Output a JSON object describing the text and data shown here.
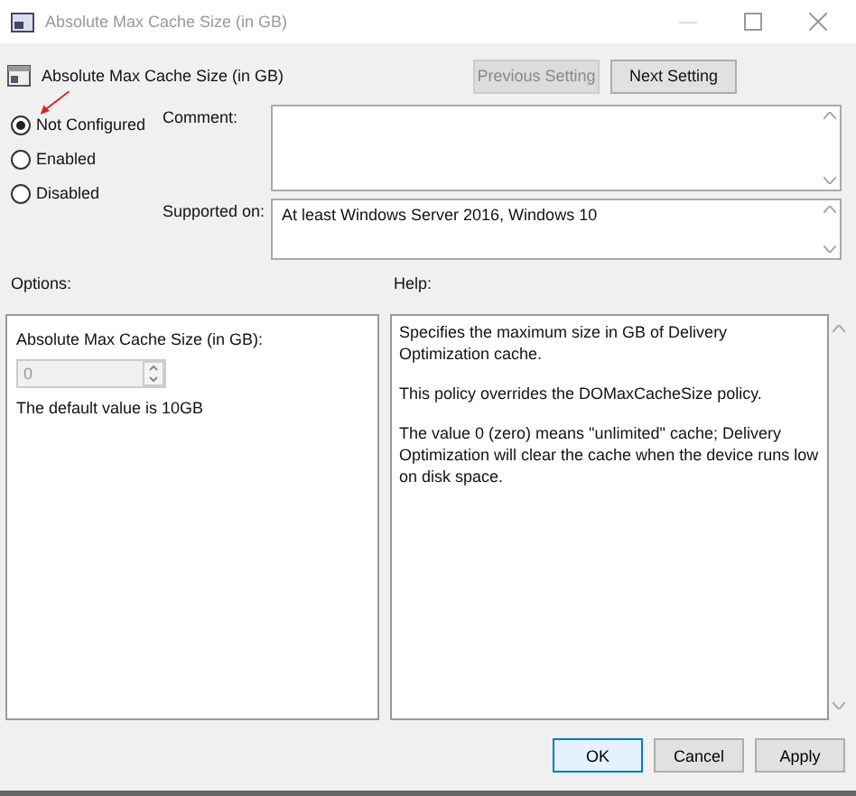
{
  "window": {
    "title": "Absolute Max Cache Size (in GB)"
  },
  "policy_title": "Absolute Max Cache Size (in GB)",
  "nav_buttons": [
    {
      "label": "Previous Setting",
      "disabled": true
    },
    {
      "label": "Next Setting",
      "disabled": false
    }
  ],
  "state_options": [
    {
      "label": "Not Configured",
      "selected": true
    },
    {
      "label": "Enabled",
      "selected": false
    },
    {
      "label": "Disabled",
      "selected": false
    }
  ],
  "comment": {
    "label": "Comment:"
  },
  "supported_on": {
    "label": "Supported on:",
    "value": "At least Windows Server 2016, Windows 10"
  },
  "options": {
    "label": "Options:",
    "field_label": "Absolute Max Cache Size (in GB):",
    "value": "0",
    "disabled": true,
    "note": "The default value is 10GB"
  },
  "help": {
    "label": "Help:",
    "paragraphs": [
      "Specifies the maximum size in GB of Delivery Optimization cache.",
      "This policy overrides the DOMaxCacheSize policy.",
      "The value 0 (zero) means \"unlimited\" cache; Delivery Optimization will clear the cache when the device runs low on disk space."
    ]
  },
  "buttons": [
    {
      "label": "OK",
      "default": true
    },
    {
      "label": "Cancel",
      "default": false
    },
    {
      "label": "Apply",
      "default": false
    }
  ]
}
